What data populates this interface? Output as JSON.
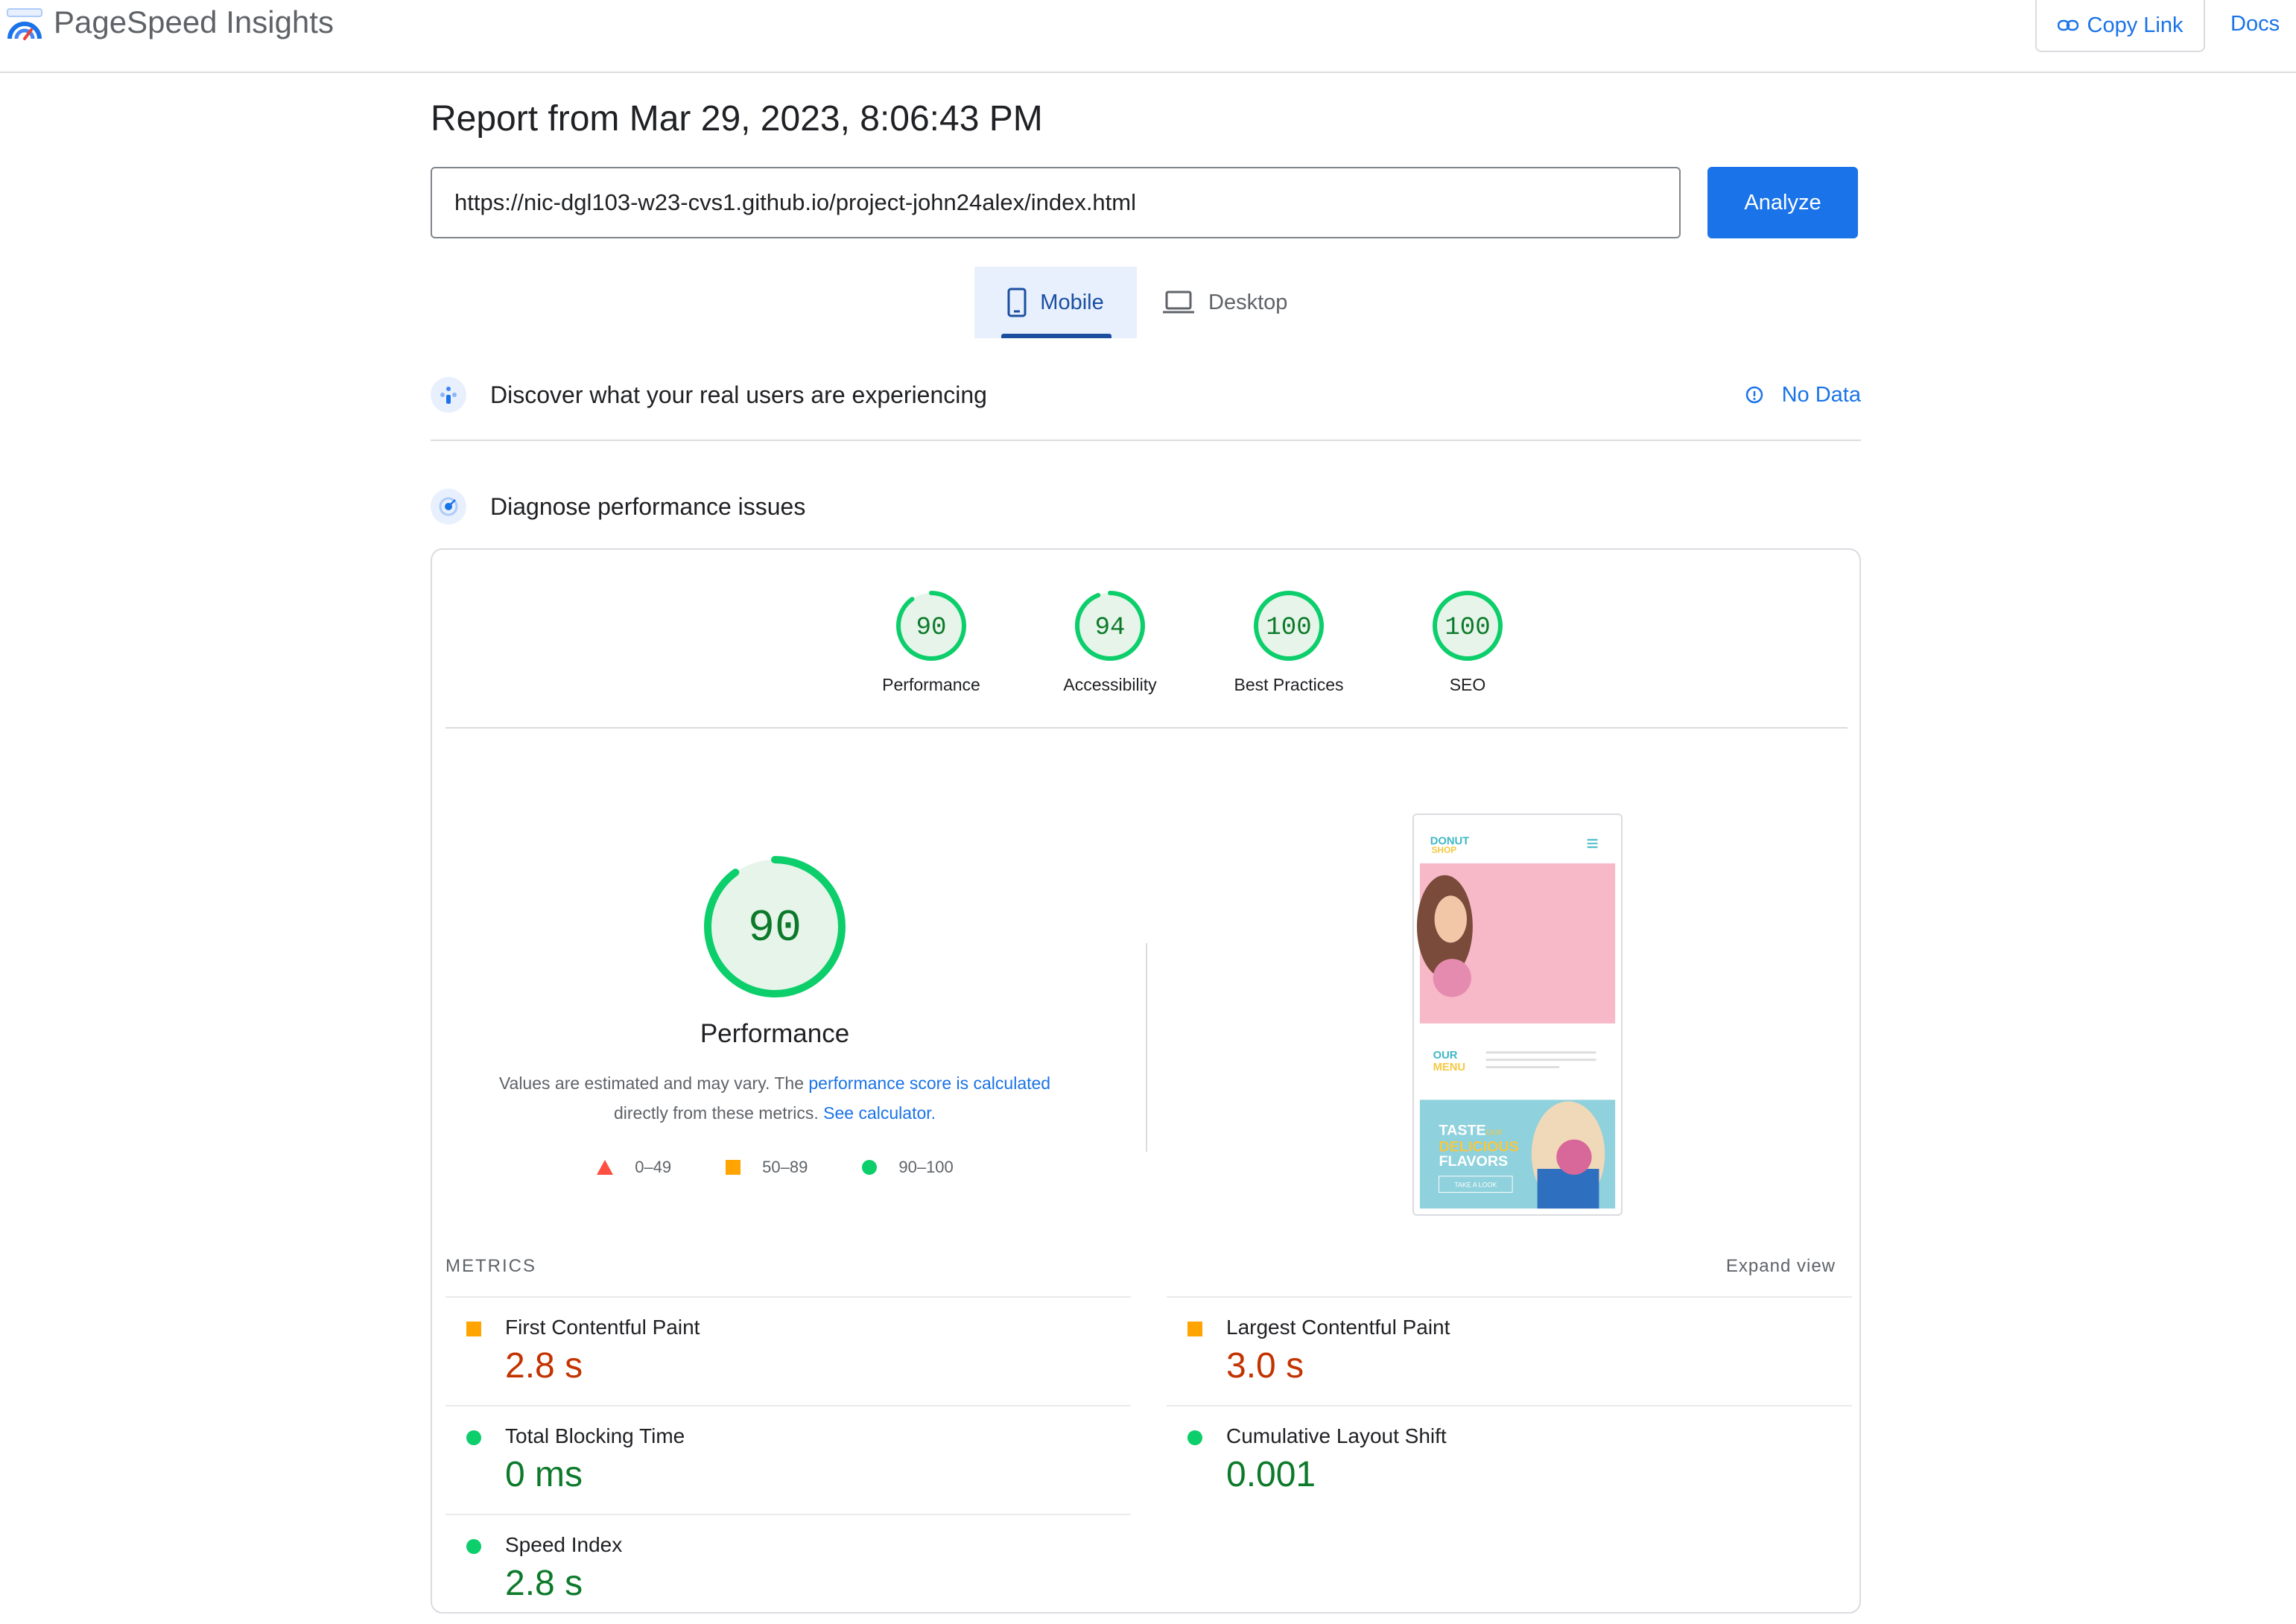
{
  "header": {
    "brand": "PageSpeed Insights",
    "copy_link": "Copy Link",
    "docs": "Docs"
  },
  "report": {
    "title": "Report from Mar 29, 2023, 8:06:43 PM",
    "url": "https://nic-dgl103-w23-cvs1.github.io/project-john24alex/index.html",
    "analyze": "Analyze"
  },
  "tabs": {
    "mobile": "Mobile",
    "desktop": "Desktop"
  },
  "discover": {
    "title": "Discover what your real users are experiencing",
    "status": "No Data"
  },
  "diagnose": {
    "title": "Diagnose performance issues"
  },
  "scores": [
    {
      "label": "Performance",
      "value": "90"
    },
    {
      "label": "Accessibility",
      "value": "94"
    },
    {
      "label": "Best Practices",
      "value": "100"
    },
    {
      "label": "SEO",
      "value": "100"
    }
  ],
  "performance": {
    "score": "90",
    "title": "Performance",
    "desc_prefix": "Values are estimated and may vary. The ",
    "desc_link1": "performance score is calculated",
    "desc_mid": " directly from these metrics. ",
    "desc_link2": "See calculator.",
    "legend": [
      "0–49",
      "50–89",
      "90–100"
    ]
  },
  "screenshot": {
    "logo_line1": "DONUT",
    "logo_line2": "SHOP",
    "our": "OUR",
    "menu": "MENU",
    "taste": "TASTE",
    "our_small": "OUR",
    "delicious": "DELICIOUS",
    "flavors": "FLAVORS",
    "take_look": "TAKE A LOOK"
  },
  "metrics": {
    "title": "METRICS",
    "expand": "Expand view",
    "items": [
      {
        "name": "First Contentful Paint",
        "value": "2.8 s",
        "rating": "average"
      },
      {
        "name": "Largest Contentful Paint",
        "value": "3.0 s",
        "rating": "average"
      },
      {
        "name": "Total Blocking Time",
        "value": "0 ms",
        "rating": "good"
      },
      {
        "name": "Cumulative Layout Shift",
        "value": "0.001",
        "rating": "good"
      },
      {
        "name": "Speed Index",
        "value": "2.8 s",
        "rating": "good"
      }
    ]
  },
  "colors": {
    "accent": "#1a73e8",
    "good": "#0cce6b",
    "average": "#ffa400",
    "poor": "#ff4e42"
  }
}
